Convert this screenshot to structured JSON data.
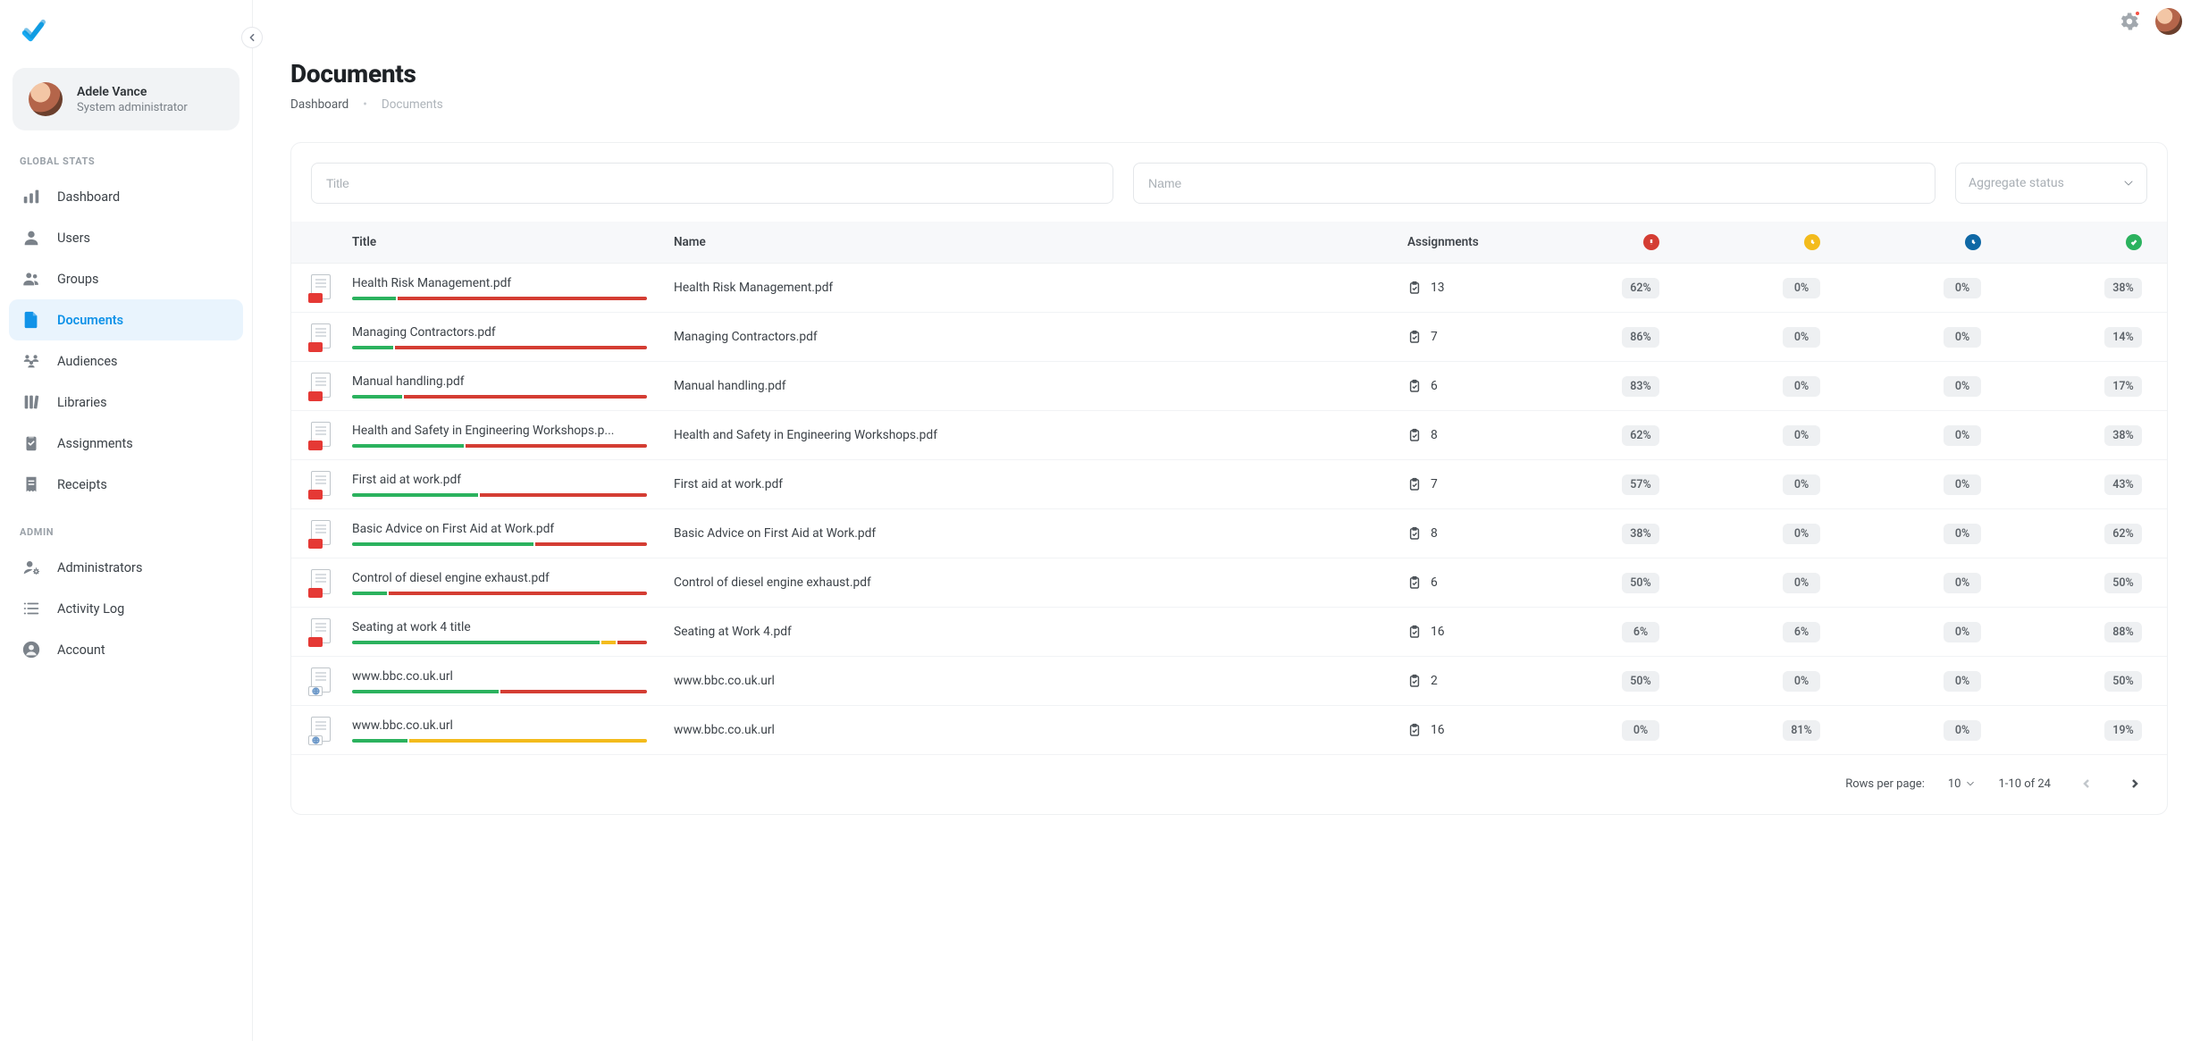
{
  "user": {
    "name": "Adele Vance",
    "role": "System administrator"
  },
  "sidebar": {
    "section_global": "GLOBAL STATS",
    "section_admin": "ADMIN",
    "items_global": [
      {
        "label": "Dashboard",
        "icon": "bar-chart"
      },
      {
        "label": "Users",
        "icon": "user"
      },
      {
        "label": "Groups",
        "icon": "users"
      },
      {
        "label": "Documents",
        "icon": "file",
        "active": true
      },
      {
        "label": "Audiences",
        "icon": "audience"
      },
      {
        "label": "Libraries",
        "icon": "library"
      },
      {
        "label": "Assignments",
        "icon": "clipboard"
      },
      {
        "label": "Receipts",
        "icon": "receipt"
      }
    ],
    "items_admin": [
      {
        "label": "Administrators",
        "icon": "admin"
      },
      {
        "label": "Activity Log",
        "icon": "list"
      },
      {
        "label": "Account",
        "icon": "account"
      }
    ]
  },
  "page": {
    "title": "Documents",
    "breadcrumb": {
      "root": "Dashboard",
      "current": "Documents"
    }
  },
  "filters": {
    "title_placeholder": "Title",
    "name_placeholder": "Name",
    "status_placeholder": "Aggregate status"
  },
  "table": {
    "headers": {
      "title": "Title",
      "name": "Name",
      "assignments": "Assignments"
    },
    "rows": [
      {
        "title": "Health Risk Management.pdf",
        "name": "Health Risk Management.pdf",
        "assignments": 13,
        "red": "62%",
        "yellow": "0%",
        "blue": "0%",
        "green": "38%",
        "type": "pdf",
        "bar": {
          "g": 15,
          "y": 0,
          "b": 0,
          "r": 85
        }
      },
      {
        "title": "Managing Contractors.pdf",
        "name": "Managing Contractors.pdf",
        "assignments": 7,
        "red": "86%",
        "yellow": "0%",
        "blue": "0%",
        "green": "14%",
        "type": "pdf",
        "bar": {
          "g": 14,
          "y": 0,
          "b": 0,
          "r": 86
        }
      },
      {
        "title": "Manual handling.pdf",
        "name": "Manual handling.pdf",
        "assignments": 6,
        "red": "83%",
        "yellow": "0%",
        "blue": "0%",
        "green": "17%",
        "type": "pdf",
        "bar": {
          "g": 17,
          "y": 0,
          "b": 0,
          "r": 83
        }
      },
      {
        "title": "Health and Safety in Engineering Workshops.p...",
        "name": "Health and Safety in Engineering Workshops.pdf",
        "assignments": 8,
        "red": "62%",
        "yellow": "0%",
        "blue": "0%",
        "green": "38%",
        "type": "pdf",
        "bar": {
          "g": 38,
          "y": 0,
          "b": 0,
          "r": 62
        }
      },
      {
        "title": "First aid at work.pdf",
        "name": "First aid at work.pdf",
        "assignments": 7,
        "red": "57%",
        "yellow": "0%",
        "blue": "0%",
        "green": "43%",
        "type": "pdf",
        "bar": {
          "g": 43,
          "y": 0,
          "b": 0,
          "r": 57
        }
      },
      {
        "title": "Basic Advice on First Aid at Work.pdf",
        "name": "Basic Advice on First Aid at Work.pdf",
        "assignments": 8,
        "red": "38%",
        "yellow": "0%",
        "blue": "0%",
        "green": "62%",
        "type": "pdf",
        "bar": {
          "g": 62,
          "y": 0,
          "b": 0,
          "r": 38
        }
      },
      {
        "title": "Control of diesel engine exhaust.pdf",
        "name": "Control of diesel engine exhaust.pdf",
        "assignments": 6,
        "red": "50%",
        "yellow": "0%",
        "blue": "0%",
        "green": "50%",
        "type": "pdf",
        "bar": {
          "g": 12,
          "y": 0,
          "b": 0,
          "r": 88
        }
      },
      {
        "title": "Seating at work 4 title",
        "name": "Seating at Work 4.pdf",
        "assignments": 16,
        "red": "6%",
        "yellow": "6%",
        "blue": "0%",
        "green": "88%",
        "type": "pdf",
        "bar": {
          "g": 85,
          "y": 5,
          "b": 0,
          "r": 10
        }
      },
      {
        "title": "www.bbc.co.uk.url",
        "name": "www.bbc.co.uk.url",
        "assignments": 2,
        "red": "50%",
        "yellow": "0%",
        "blue": "0%",
        "green": "50%",
        "type": "url",
        "bar": {
          "g": 50,
          "y": 0,
          "b": 0,
          "r": 50
        }
      },
      {
        "title": "www.bbc.co.uk.url",
        "name": "www.bbc.co.uk.url",
        "assignments": 16,
        "red": "0%",
        "yellow": "81%",
        "blue": "0%",
        "green": "19%",
        "type": "url",
        "bar": {
          "g": 19,
          "y": 81,
          "b": 0,
          "r": 0
        }
      }
    ]
  },
  "pagination": {
    "rows_label": "Rows per page:",
    "rows_value": "10",
    "range": "1-10 of 24"
  }
}
